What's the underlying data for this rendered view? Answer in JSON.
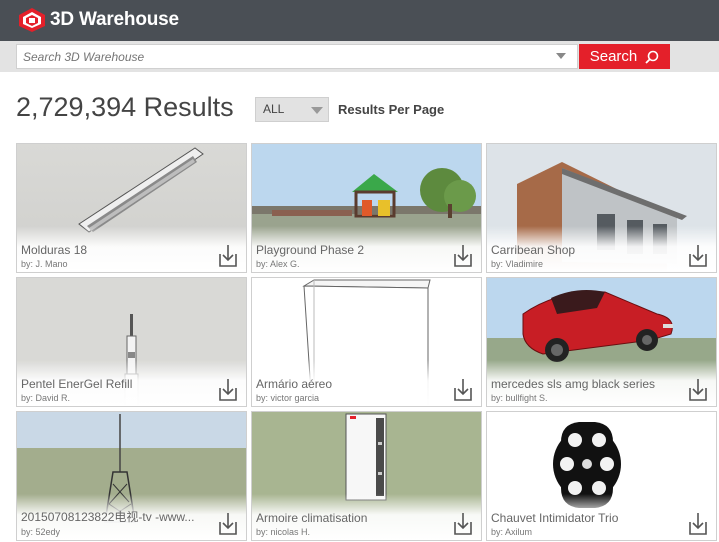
{
  "header": {
    "logo_text": "3D Warehouse"
  },
  "search": {
    "placeholder": "Search 3D Warehouse",
    "button_label": "Search"
  },
  "results": {
    "count_label": "2,729,394 Results",
    "per_page_value": "ALL",
    "per_page_label": "Results Per Page"
  },
  "colors": {
    "topbar": "#4a4f55",
    "accent": "#e4202a",
    "searchbar": "#e3e3e3"
  },
  "cards": [
    {
      "title": "Molduras 18",
      "author": "by: J. Mano"
    },
    {
      "title": "Playground Phase 2",
      "author": "by: Alex G."
    },
    {
      "title": "Carribean Shop",
      "author": "by: Vladimire"
    },
    {
      "title": "Pentel EnerGel Refill",
      "author": "by: David R."
    },
    {
      "title": "Armário aéreo",
      "author": "by: victor garcia"
    },
    {
      "title": "mercedes sls amg black series",
      "author": "by: bullfight S."
    },
    {
      "title": "20150708123822电视-tv -www...",
      "author": "by: 52edy"
    },
    {
      "title": "Armoire climatisation",
      "author": "by: nicolas H."
    },
    {
      "title": "Chauvet Intimidator Trio",
      "author": "by: Axilum"
    }
  ]
}
